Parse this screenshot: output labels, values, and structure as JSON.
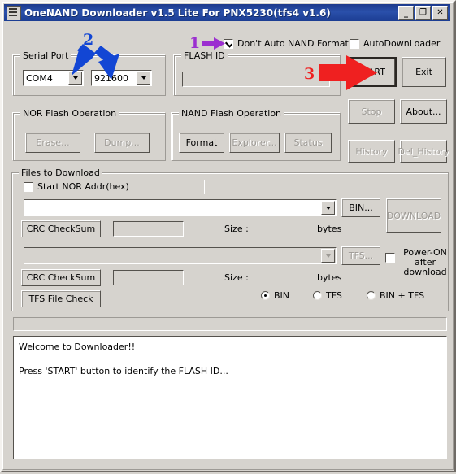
{
  "window": {
    "title": "OneNAND Downloader v1.5 Lite For PNX5230(tfs4 v1.6)",
    "minimize_label": "_",
    "maximize_label": "❐",
    "close_label": "✕"
  },
  "serial_port": {
    "group_label": "Serial Port",
    "port_value": "COM4",
    "baud_value": "921600"
  },
  "flash_id": {
    "group_label": "FLASH ID",
    "value": ""
  },
  "top_checks": {
    "dont_auto_nand_format": "Don't Auto NAND Format",
    "dont_auto_nand_format_checked": true,
    "auto_downloader": "AutoDownLoader",
    "auto_downloader_checked": false
  },
  "action_buttons": {
    "start": "START",
    "exit": "Exit",
    "stop": "Stop",
    "about": "About...",
    "history": "History",
    "del_history": "Del_History"
  },
  "nor_flash": {
    "group_label": "NOR Flash Operation",
    "erase": "Erase...",
    "dump": "Dump..."
  },
  "nand_flash": {
    "group_label": "NAND Flash Operation",
    "format": "Format",
    "explorer": "Explorer...",
    "status": "Status"
  },
  "files_to_download": {
    "group_label": "Files to Download",
    "start_nor_addr_label": "Start NOR Addr(hex):",
    "start_nor_addr_checked": false,
    "start_nor_addr_value": "",
    "bin_path_value": "",
    "bin_button": "BIN...",
    "download_button": "DOWNLOAD",
    "crc_checksum_1": "CRC CheckSum",
    "crc_value_1": "",
    "size_label_1": "Size :",
    "bytes_label_1": "bytes",
    "tfs_path_value": "",
    "tfs_button": "TFS...",
    "power_on_line1": "Power-ON",
    "power_on_line2": "after",
    "power_on_line3": "download",
    "power_on_checked": false,
    "crc_checksum_2": "CRC CheckSum",
    "crc_value_2": "",
    "size_label_2": "Size :",
    "bytes_label_2": "bytes",
    "tfs_file_check": "TFS File Check",
    "radio_bin": "BIN",
    "radio_tfs": "TFS",
    "radio_bin_tfs": "BIN + TFS",
    "radio_selected": "BIN"
  },
  "log": {
    "line1": "Welcome to Downloader!!",
    "line2": "",
    "line3": "Press 'START' button to identify the FLASH ID..."
  },
  "annotations": {
    "one": "1",
    "two": "2",
    "three": "3",
    "color_purple": "#9b2fd0",
    "color_blue": "#1246d4",
    "color_red": "#ef2020"
  }
}
